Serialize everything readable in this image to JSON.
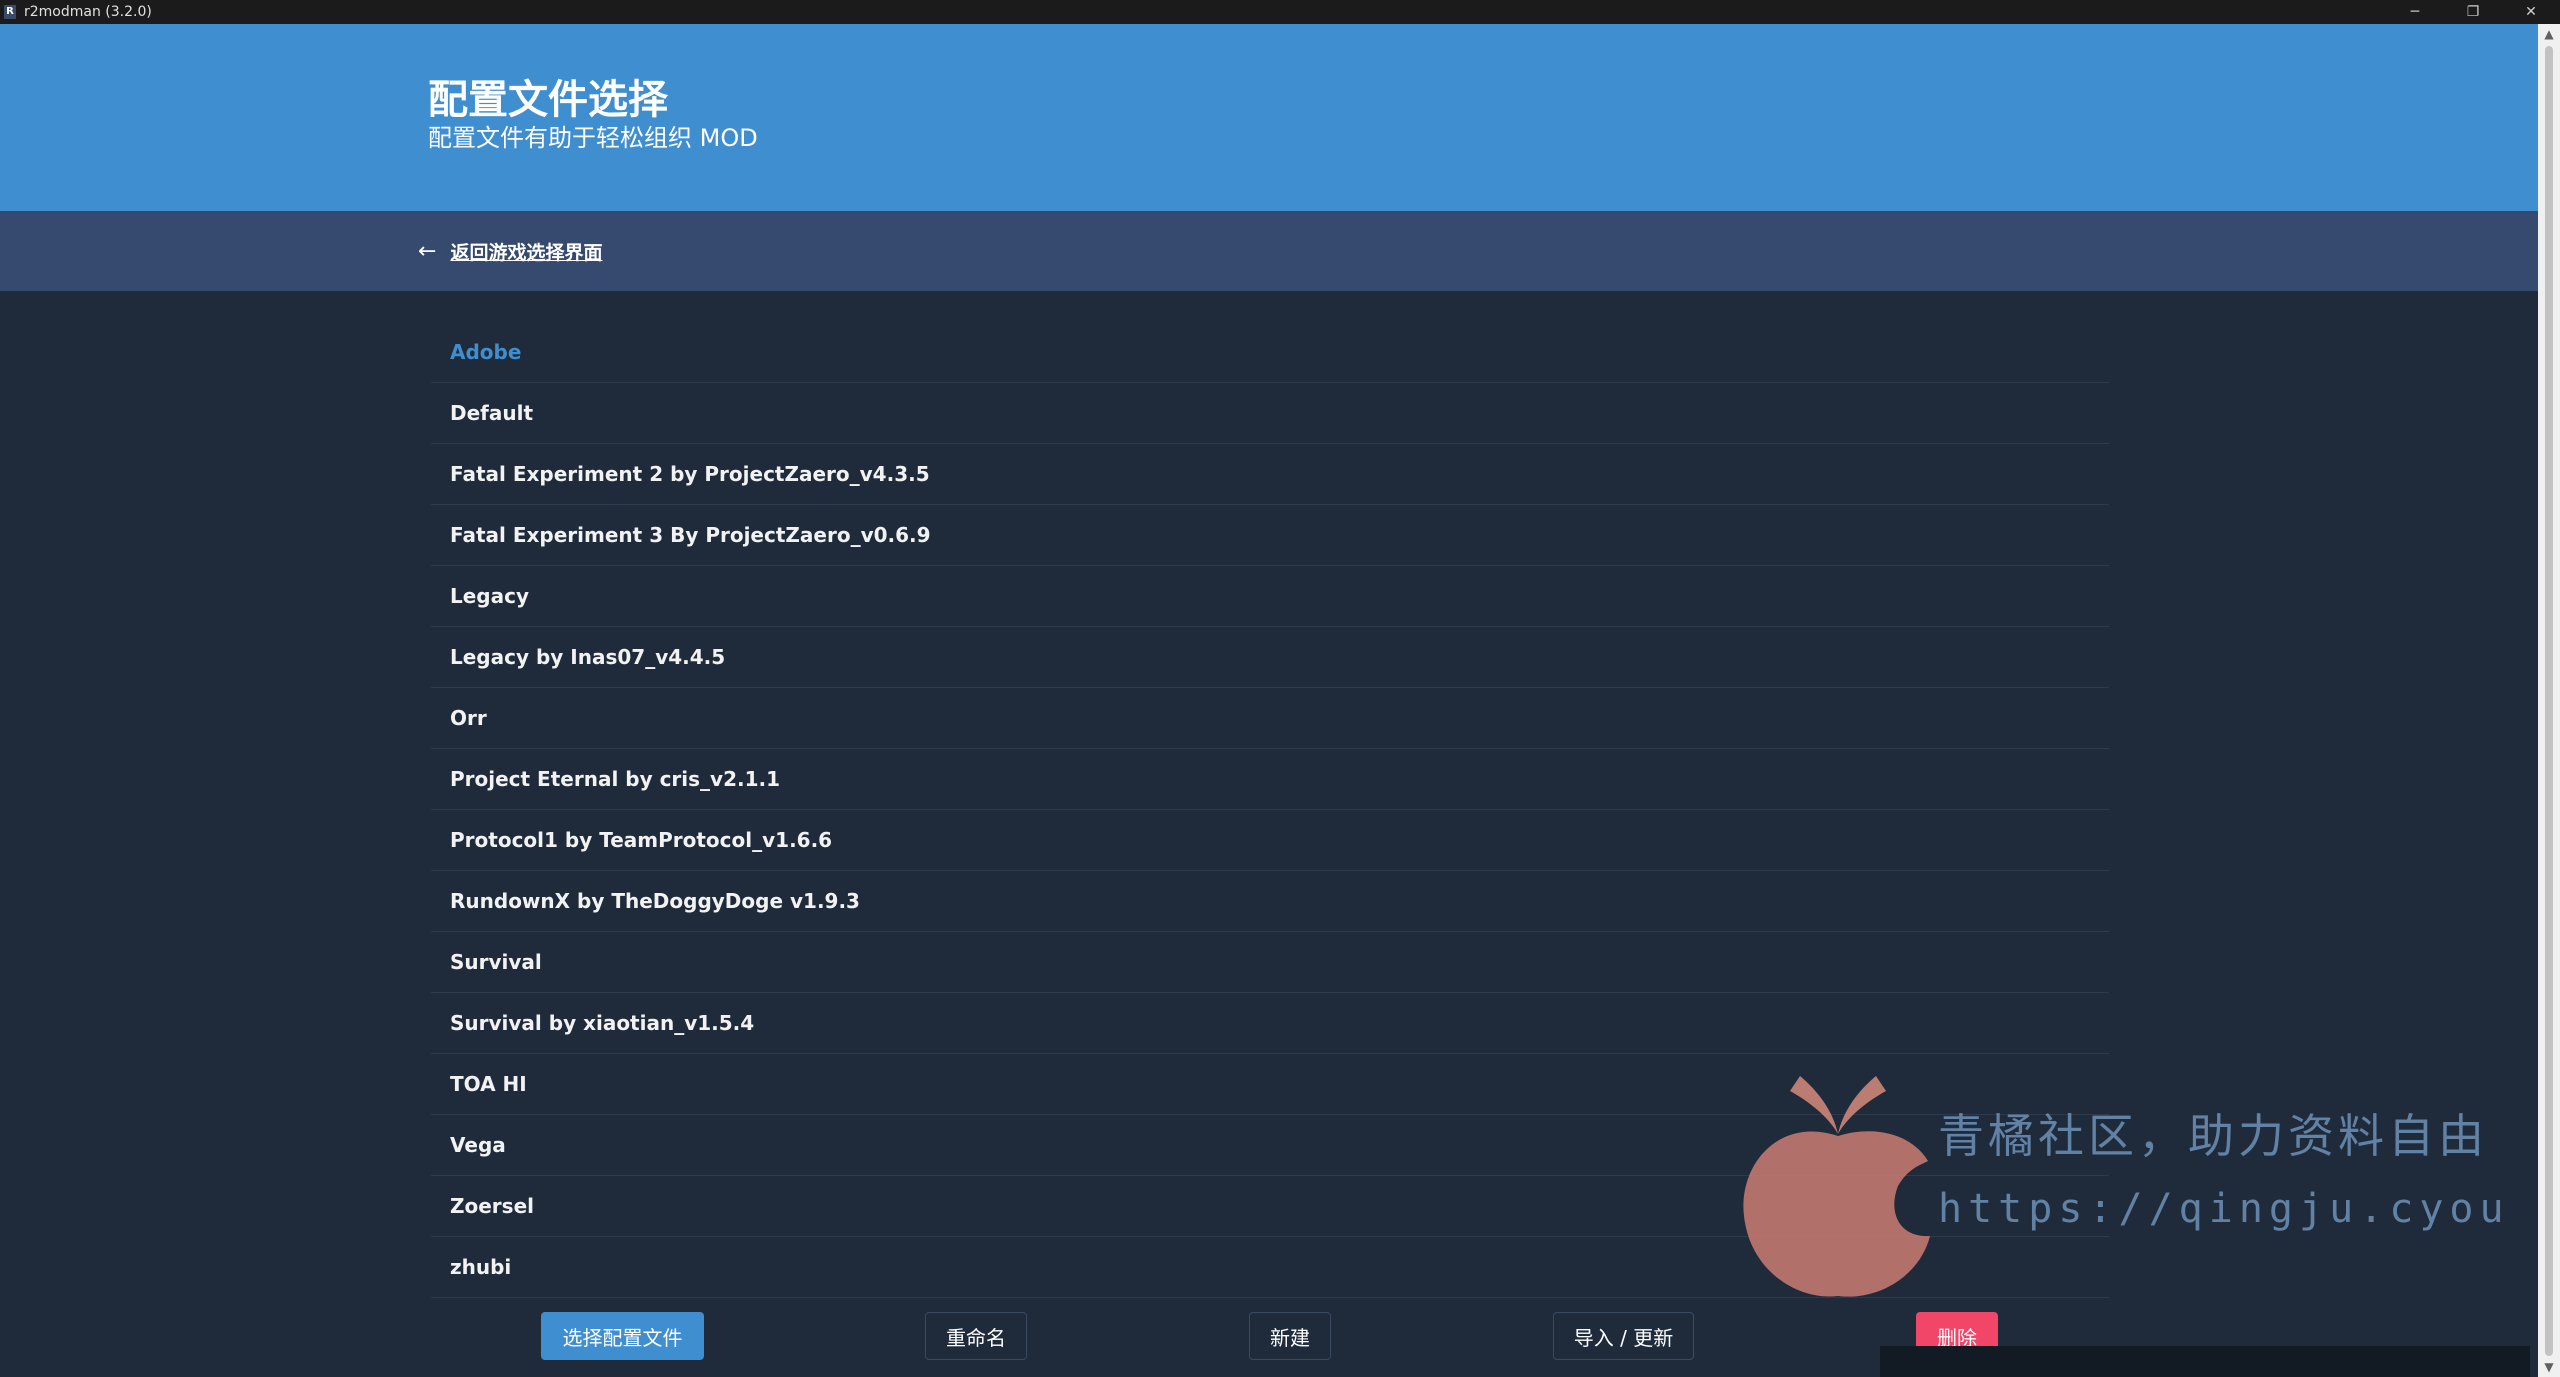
{
  "window": {
    "title": "r2modman (3.2.0)",
    "icon_letter": "R",
    "controls": {
      "minimize": "─",
      "maximize": "❐",
      "close": "✕"
    }
  },
  "hero": {
    "title": "配置文件选择",
    "subtitle": "配置文件有助于轻松组织 MOD"
  },
  "nav": {
    "back_arrow": "←",
    "back_label": "返回游戏选择界面"
  },
  "profiles": [
    {
      "name": "Adobe",
      "active": true
    },
    {
      "name": "Default"
    },
    {
      "name": "Fatal Experiment 2 by ProjectZaero_v4.3.5"
    },
    {
      "name": "Fatal Experiment 3 By ProjectZaero_v0.6.9"
    },
    {
      "name": "Legacy"
    },
    {
      "name": "Legacy by Inas07_v4.4.5"
    },
    {
      "name": "Orr"
    },
    {
      "name": "Project Eternal by cris_v2.1.1"
    },
    {
      "name": "Protocol1 by TeamProtocol_v1.6.6"
    },
    {
      "name": "RundownX by TheDoggyDoge v1.9.3"
    },
    {
      "name": "Survival"
    },
    {
      "name": "Survival by xiaotian_v1.5.4"
    },
    {
      "name": "TOA HI"
    },
    {
      "name": "Vega"
    },
    {
      "name": "Zoersel"
    },
    {
      "name": "zhubi"
    }
  ],
  "buttons": {
    "select": "选择配置文件",
    "rename": "重命名",
    "new": "新建",
    "import": "导入 / 更新",
    "delete": "删除"
  },
  "watermark": {
    "line1": "青橘社区，助力资料自由",
    "line2": "https://qingju.cyou"
  },
  "colors": {
    "accent": "#3e8ed0",
    "danger": "#f14668",
    "background": "#1f2b3b",
    "nav": "#354a6e"
  }
}
